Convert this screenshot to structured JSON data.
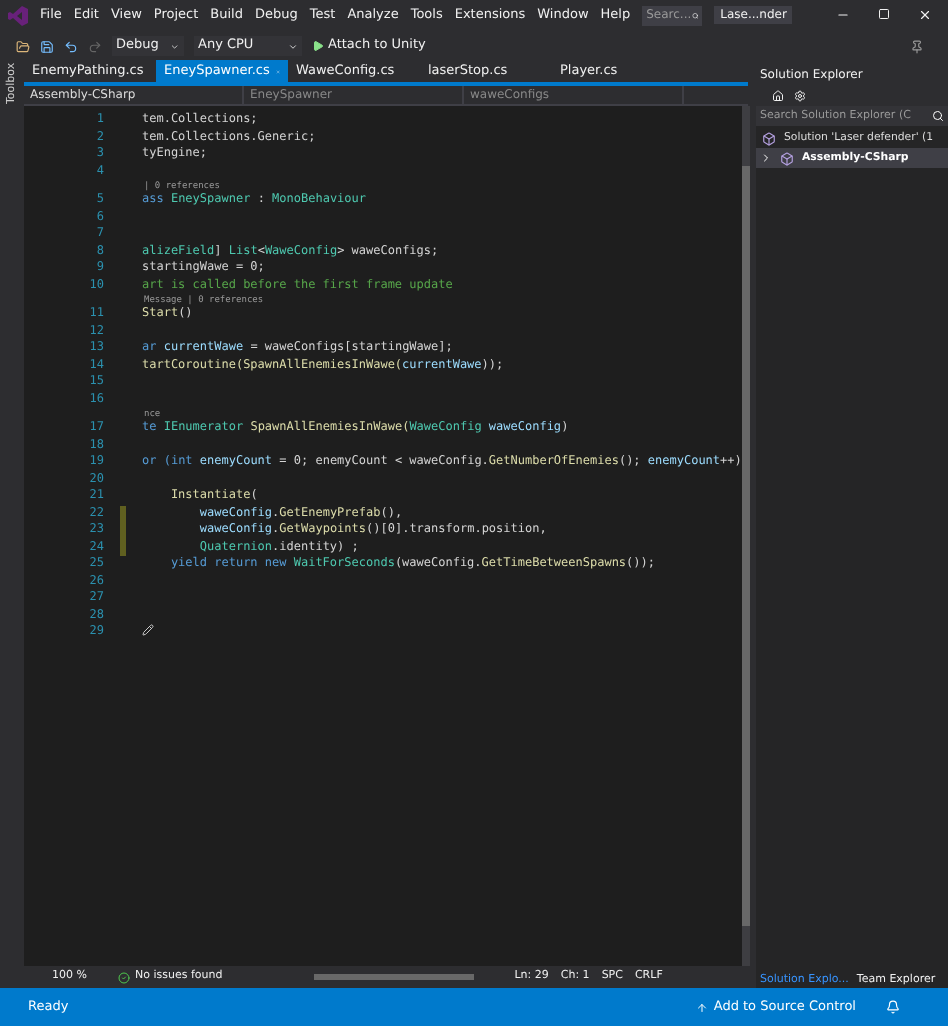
{
  "window": {
    "title": "Lase...nder",
    "search_placeholder": "Searc..."
  },
  "menu": [
    "File",
    "Edit",
    "View",
    "Project",
    "Build",
    "Debug",
    "Test",
    "Analyze",
    "Tools",
    "Extensions",
    "Window",
    "Help"
  ],
  "toolbar": {
    "configuration": "Debug",
    "platform": "Any CPU",
    "run": "Attach to Unity"
  },
  "side_toolbox": "Toolbox",
  "tabs": [
    {
      "label": "EnemyPathing.cs",
      "selected": false
    },
    {
      "label": "EneySpawner.cs",
      "selected": true
    },
    {
      "label": "WaweConfig.cs",
      "selected": false
    },
    {
      "label": "laserStop.cs",
      "selected": false
    },
    {
      "label": "Player.cs",
      "selected": false
    }
  ],
  "nav_bar": [
    "Assembly-CSharp",
    "EneySpawner",
    "waweConfigs"
  ],
  "code": [
    {
      "kind": "line",
      "number": "1",
      "changed": false,
      "tokens": [
        {
          "t": "tem.Collections;",
          "kind": "plain"
        }
      ]
    },
    {
      "kind": "line",
      "number": "2",
      "changed": false,
      "tokens": [
        {
          "t": "tem.Collections.Generic;",
          "kind": "plain"
        }
      ]
    },
    {
      "kind": "line",
      "number": "3",
      "changed": false,
      "tokens": [
        {
          "t": "tyEngine;",
          "kind": "plain"
        }
      ]
    },
    {
      "kind": "line",
      "number": "4",
      "changed": false
    },
    {
      "kind": "lens",
      "text": "| 0 references"
    },
    {
      "kind": "line",
      "number": "5",
      "changed": false,
      "tokens": [
        {
          "t": "ass ",
          "kind": "keyword"
        },
        {
          "t": "EneySpawner",
          "kind": "type"
        },
        {
          "t": " : ",
          "kind": "plain"
        },
        {
          "t": "MonoBehaviour",
          "kind": "type"
        }
      ]
    },
    {
      "kind": "line",
      "number": "6",
      "changed": false
    },
    {
      "kind": "line",
      "number": "7",
      "changed": false
    },
    {
      "kind": "line",
      "number": "8",
      "changed": false,
      "tokens": [
        {
          "t": "alizeField",
          "kind": "type"
        },
        {
          "t": "] ",
          "kind": "plain"
        },
        {
          "t": "List",
          "kind": "type"
        },
        {
          "t": "<",
          "kind": "plain"
        },
        {
          "t": "WaweConfig",
          "kind": "type"
        },
        {
          "t": "> waweConfigs;",
          "kind": "plain"
        }
      ]
    },
    {
      "kind": "line",
      "number": "9",
      "changed": false,
      "tokens": [
        {
          "t": "startingWawe = 0;",
          "kind": "plain"
        }
      ]
    },
    {
      "kind": "line",
      "number": "10",
      "changed": false,
      "tokens": [
        {
          "t": "art is called before the first frame update",
          "kind": "comment"
        }
      ]
    },
    {
      "kind": "lens",
      "text": "Message | 0 references"
    },
    {
      "kind": "line",
      "number": "11",
      "changed": false,
      "tokens": [
        {
          "t": "Start",
          "kind": "method"
        },
        {
          "t": "()",
          "kind": "plain"
        }
      ]
    },
    {
      "kind": "line",
      "number": "12",
      "changed": false
    },
    {
      "kind": "line",
      "number": "13",
      "changed": false,
      "tokens": [
        {
          "t": "ar ",
          "kind": "keyword"
        },
        {
          "t": "currentWawe",
          "kind": "param"
        },
        {
          "t": " = waweConfigs[startingWawe];",
          "kind": "plain"
        }
      ]
    },
    {
      "kind": "line",
      "number": "14",
      "changed": false,
      "tokens": [
        {
          "t": "tartCoroutine(SpawnAllEnemiesInWawe(",
          "kind": "method"
        },
        {
          "t": "currentWawe",
          "kind": "param"
        },
        {
          "t": "));",
          "kind": "plain"
        }
      ]
    },
    {
      "kind": "line",
      "number": "15",
      "changed": false
    },
    {
      "kind": "line",
      "number": "16",
      "changed": false
    },
    {
      "kind": "lens",
      "text": "nce"
    },
    {
      "kind": "line",
      "number": "17",
      "changed": false,
      "tokens": [
        {
          "t": "te ",
          "kind": "keyword"
        },
        {
          "t": "IEnumerator",
          "kind": "type"
        },
        {
          "t": " SpawnAllEnemiesInWawe(",
          "kind": "method"
        },
        {
          "t": "WaweConfig",
          "kind": "type"
        },
        {
          "t": " waweConfig",
          "kind": "param"
        },
        {
          "t": ")",
          "kind": "plain"
        }
      ]
    },
    {
      "kind": "line",
      "number": "18",
      "changed": false
    },
    {
      "kind": "line",
      "number": "19",
      "changed": false,
      "tokens": [
        {
          "t": "or (",
          "kind": "keyword"
        },
        {
          "t": "int",
          "kind": "keyword"
        },
        {
          "t": " enemyCount",
          "kind": "param"
        },
        {
          "t": " = 0; enemyCount < waweConfig.",
          "kind": "plain"
        },
        {
          "t": "GetNumberOfEnemies",
          "kind": "method"
        },
        {
          "t": "(); ",
          "kind": "plain"
        },
        {
          "t": "enemyCount",
          "kind": "param"
        },
        {
          "t": "++)",
          "kind": "plain"
        }
      ]
    },
    {
      "kind": "line",
      "number": "20",
      "changed": false
    },
    {
      "kind": "line",
      "number": "21",
      "changed": false,
      "tokens": [
        {
          "t": "    Instantiate",
          "kind": "method"
        },
        {
          "t": "(",
          "kind": "plain"
        }
      ]
    },
    {
      "kind": "line",
      "number": "22",
      "changed": true,
      "tokens": [
        {
          "t": "        waweConfig",
          "kind": "param"
        },
        {
          "t": ".",
          "kind": "plain"
        },
        {
          "t": "GetEnemyPrefab",
          "kind": "method"
        },
        {
          "t": "(),",
          "kind": "plain"
        }
      ]
    },
    {
      "kind": "line",
      "number": "23",
      "changed": true,
      "tokens": [
        {
          "t": "        waweConfig",
          "kind": "param"
        },
        {
          "t": ".",
          "kind": "plain"
        },
        {
          "t": "GetWaypoints",
          "kind": "method"
        },
        {
          "t": "()[0].transform.position,",
          "kind": "plain"
        }
      ]
    },
    {
      "kind": "line",
      "number": "24",
      "changed": true,
      "tokens": [
        {
          "t": "        Quaternion",
          "kind": "type"
        },
        {
          "t": ".identity) ;",
          "kind": "plain"
        }
      ]
    },
    {
      "kind": "line",
      "number": "25",
      "changed": false,
      "tokens": [
        {
          "t": "    yield return new ",
          "kind": "keyword"
        },
        {
          "t": "WaitForSeconds",
          "kind": "type"
        },
        {
          "t": "(waweConfig.",
          "kind": "plain"
        },
        {
          "t": "GetTimeBetweenSpawns",
          "kind": "method"
        },
        {
          "t": "());",
          "kind": "plain"
        }
      ]
    },
    {
      "kind": "line",
      "number": "26",
      "changed": false
    },
    {
      "kind": "line",
      "number": "27",
      "changed": false
    },
    {
      "kind": "line",
      "number": "28",
      "changed": false
    },
    {
      "kind": "line",
      "number": "29",
      "changed": false
    }
  ],
  "solution_explorer": {
    "title": "Solution Explorer",
    "search_placeholder": "Search Solution Explorer (C",
    "tree": [
      {
        "label": "Solution 'Laser defender' (1",
        "children": [
          {
            "label": "Assembly-CSharp",
            "expanded": false,
            "selected": true
          }
        ]
      }
    ]
  },
  "editor_footer": {
    "zoom": "100 %",
    "issues": "No issues found",
    "line": "Ln: 29",
    "column": "Ch: 1",
    "indent": "SPC",
    "line_ending": "CRLF"
  },
  "panel_tabs": [
    {
      "label": "Solution Explo...",
      "selected": true
    },
    {
      "label": "Team Explorer",
      "selected": false
    }
  ],
  "status_bar": {
    "message": "Ready",
    "source_control": "Add to Source Control"
  }
}
